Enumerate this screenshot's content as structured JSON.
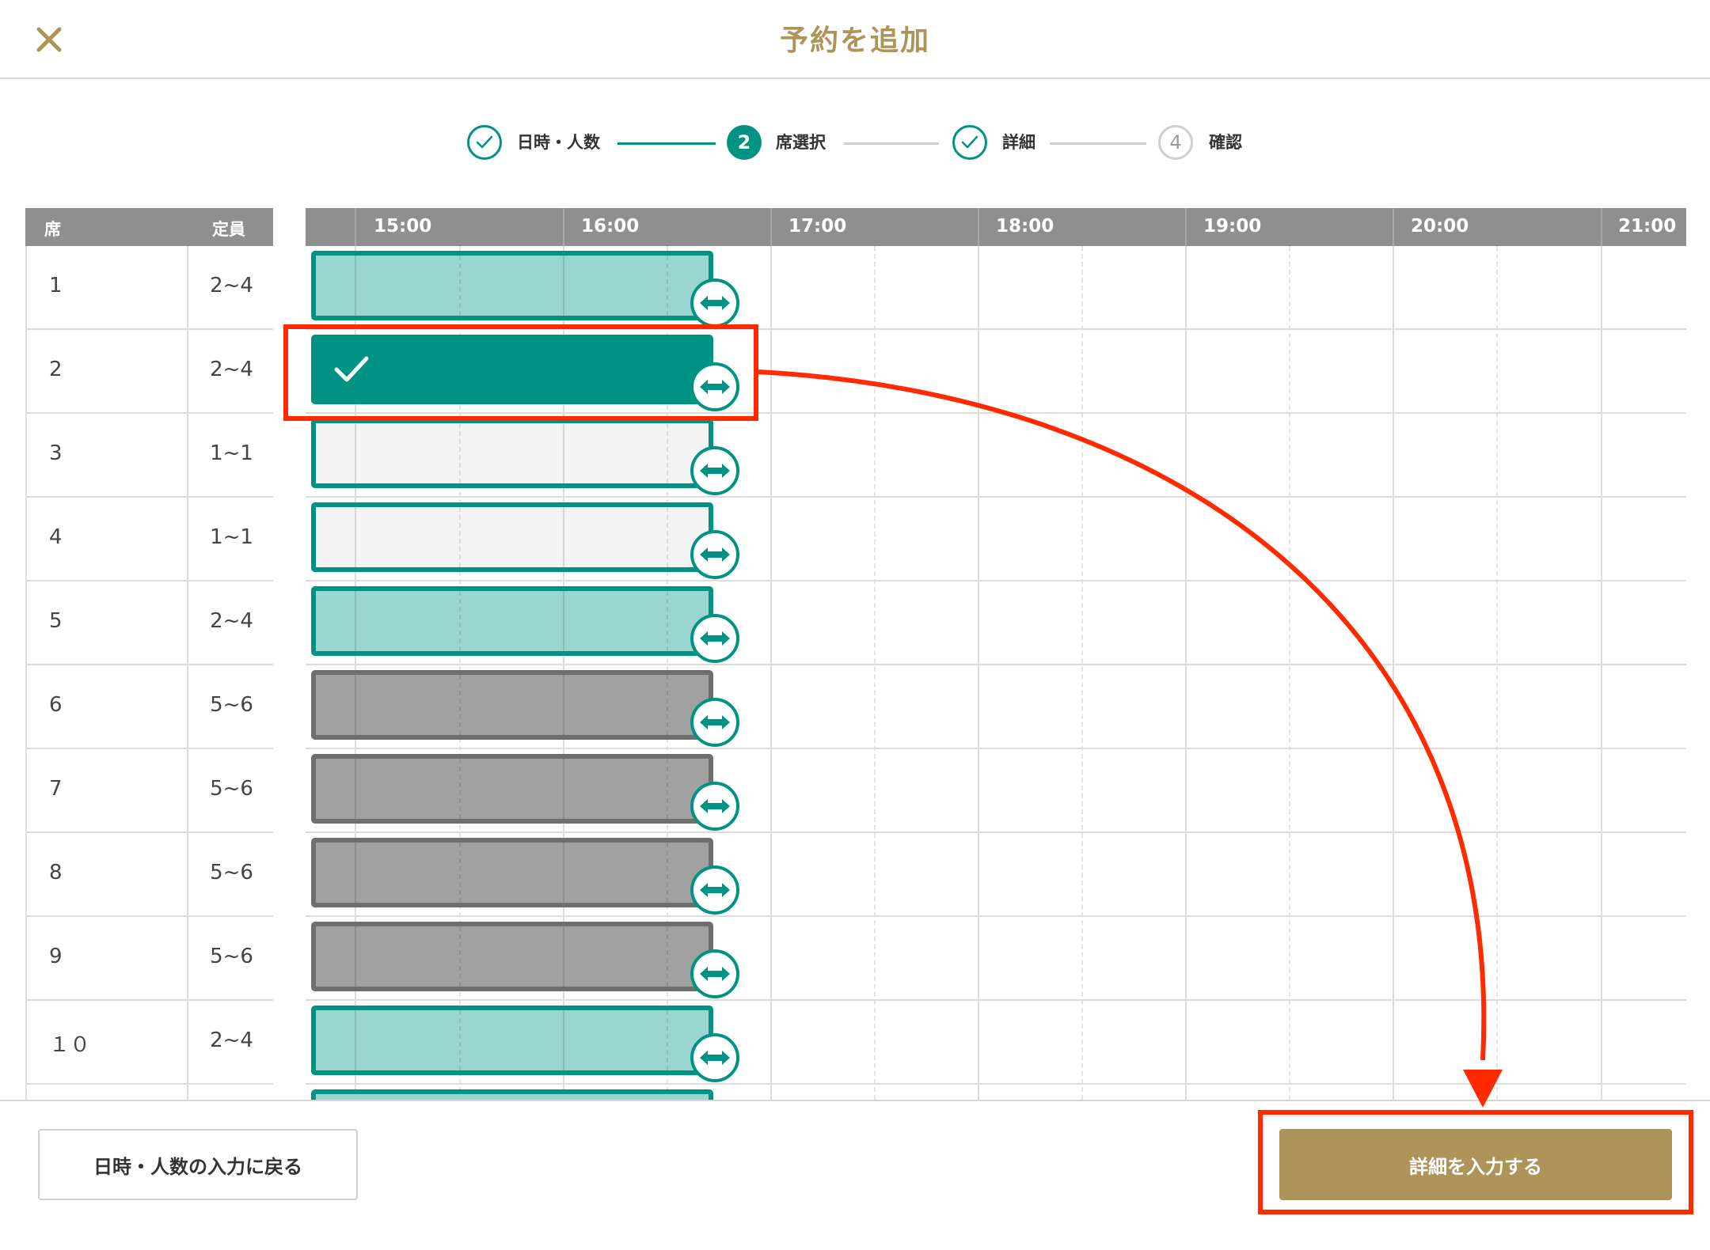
{
  "header": {
    "title": "予約を追加",
    "close_icon": "close-icon"
  },
  "stepper": {
    "steps": [
      {
        "label": "日時・人数",
        "state": "done",
        "number": ""
      },
      {
        "label": "席選択",
        "state": "current",
        "number": "2"
      },
      {
        "label": "詳細",
        "state": "done",
        "number": ""
      },
      {
        "label": "確認",
        "state": "future",
        "number": "4"
      }
    ]
  },
  "table": {
    "headers": {
      "seat": "席",
      "capacity": "定員"
    },
    "rows": [
      {
        "seat": "1",
        "capacity": "2~4",
        "status": "available"
      },
      {
        "seat": "2",
        "capacity": "2~4",
        "status": "selected"
      },
      {
        "seat": "3",
        "capacity": "1~1",
        "status": "empty"
      },
      {
        "seat": "4",
        "capacity": "1~1",
        "status": "empty"
      },
      {
        "seat": "5",
        "capacity": "2~4",
        "status": "available"
      },
      {
        "seat": "6",
        "capacity": "5~6",
        "status": "unavailable"
      },
      {
        "seat": "7",
        "capacity": "5~6",
        "status": "unavailable"
      },
      {
        "seat": "8",
        "capacity": "5~6",
        "status": "unavailable"
      },
      {
        "seat": "9",
        "capacity": "5~6",
        "status": "unavailable"
      },
      {
        "seat": "１０",
        "capacity": "2~4",
        "status": "available"
      }
    ]
  },
  "timeline": {
    "hours": [
      "15:00",
      "16:00",
      "17:00",
      "18:00",
      "19:00",
      "20:00",
      "21:00"
    ]
  },
  "footer": {
    "back_label": "日時・人数の入力に戻る",
    "next_label": "詳細を入力する"
  },
  "colors": {
    "accent_teal": "#009383",
    "teal_light": "#9ad6cf",
    "gold": "#ad9458",
    "annotation_red": "#ff2a00"
  }
}
